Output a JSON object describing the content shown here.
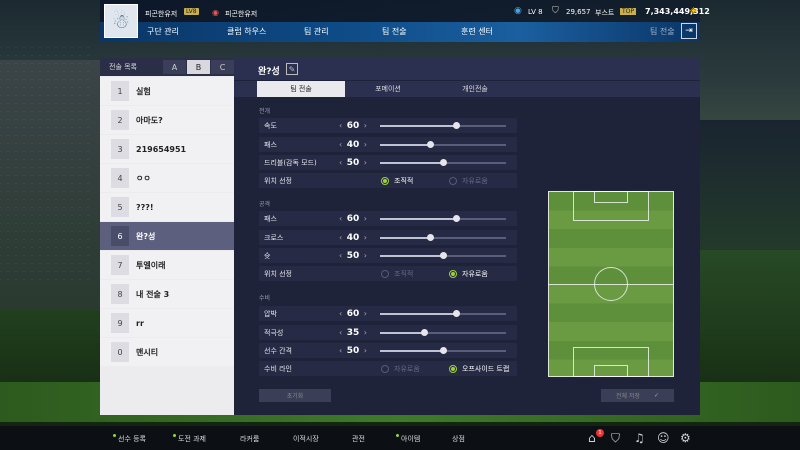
{
  "header": {
    "club_name": "피곤한유저",
    "level_tag": "LV8",
    "manager_name": "피곤한유저",
    "level": "LV 8",
    "coins": "29,657",
    "boost_label": "부스트",
    "boost_badge": "TOP",
    "money": "7,343,449,312"
  },
  "menu": {
    "items": [
      "구단 관리",
      "클럽 하우스",
      "팀 관리",
      "팀 전술",
      "훈련 센터"
    ],
    "breadcrumb": "팀 전술"
  },
  "tactics_list": {
    "header": "전술 목록",
    "tabs": [
      "A",
      "B",
      "C"
    ],
    "active_tab": "B",
    "slots": [
      {
        "num": "1",
        "name": "실험"
      },
      {
        "num": "2",
        "name": "아마도?"
      },
      {
        "num": "3",
        "name": "219654951"
      },
      {
        "num": "4",
        "name": "ㅇㅇ"
      },
      {
        "num": "5",
        "name": "???!"
      },
      {
        "num": "6",
        "name": "완?성"
      },
      {
        "num": "7",
        "name": "투엘이래"
      },
      {
        "num": "8",
        "name": "내 전술 3"
      },
      {
        "num": "9",
        "name": "rr"
      },
      {
        "num": "0",
        "name": "맨시티"
      }
    ],
    "active_index": 5
  },
  "detail": {
    "title": "완?성",
    "tabs": [
      "팀 전술",
      "포메이션",
      "개인전술"
    ],
    "active_tab": 0,
    "sections": {
      "build": {
        "label": "전개",
        "speed": {
          "label": "속도",
          "value": "60"
        },
        "passing": {
          "label": "패스",
          "value": "40"
        },
        "dribble": {
          "label": "드리블(감독 모드)",
          "value": "50"
        },
        "positioning": {
          "label": "위치 선정",
          "opt1": "조직적",
          "opt2": "자유로움",
          "selected": "조직적"
        }
      },
      "attack": {
        "label": "공격",
        "passing": {
          "label": "패스",
          "value": "60"
        },
        "crossing": {
          "label": "크로스",
          "value": "40"
        },
        "shooting": {
          "label": "슛",
          "value": "50"
        },
        "positioning": {
          "label": "위치 선정",
          "opt1": "조직적",
          "opt2": "자유로움",
          "selected": "자유로움"
        }
      },
      "defense": {
        "label": "수비",
        "pressure": {
          "label": "압박",
          "value": "60"
        },
        "aggression": {
          "label": "적극성",
          "value": "35"
        },
        "width": {
          "label": "선수 간격",
          "value": "50"
        },
        "line": {
          "label": "수비 라인",
          "opt1": "자유로움",
          "opt2": "오프사이드 트랩",
          "selected": "오프사이드 트랩"
        }
      }
    },
    "reset_label": "초기화",
    "save_label": "전체 저장"
  },
  "bottom_nav": {
    "items": [
      "선수 등록",
      "도전 과제",
      "라커룸",
      "이적시장",
      "관전",
      "아이템",
      "상점"
    ],
    "notification_count": "1"
  },
  "colors": {
    "accent_green": "#9ad23c",
    "menu_blue": "#0e4b86",
    "panel_bg": "#1f233a",
    "slot_active": "#5c5f7e"
  }
}
